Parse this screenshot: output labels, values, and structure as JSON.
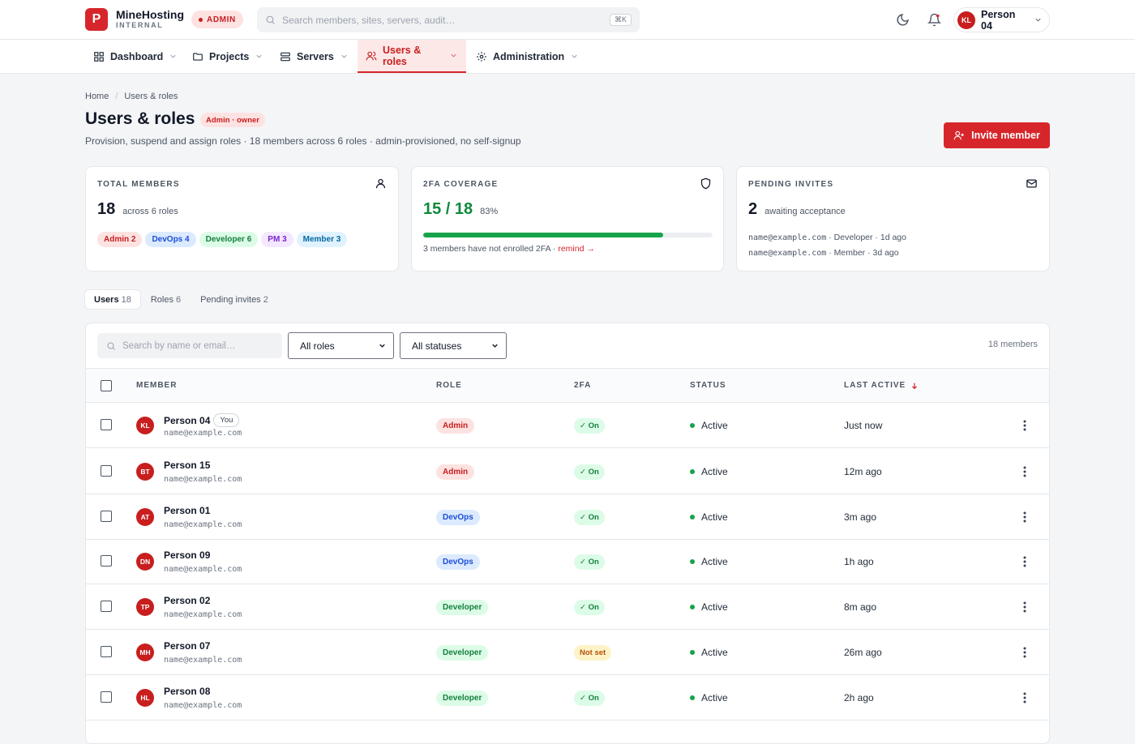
{
  "brand": {
    "logo_letter": "P",
    "name": "MineHosting",
    "sub": "INTERNAL",
    "env_badge": "ADMIN"
  },
  "search": {
    "placeholder": "Search members, sites, servers, audit…",
    "shortcut": "⌘K"
  },
  "user": {
    "initials": "KL",
    "name": "Person 04"
  },
  "nav": [
    {
      "label": "Dashboard",
      "icon": "dashboard-grid-icon"
    },
    {
      "label": "Projects",
      "icon": "folder-icon"
    },
    {
      "label": "Servers",
      "icon": "server-icon"
    },
    {
      "label": "Users & roles",
      "icon": "users-icon",
      "active": true
    },
    {
      "label": "Administration",
      "icon": "settings-icon"
    }
  ],
  "breadcrumb": [
    "Home",
    "Users & roles"
  ],
  "page": {
    "title": "Users & roles",
    "badge": "Admin · owner",
    "subtitle": "Provision, suspend and assign roles · 18 members across 6 roles · admin-provisioned, no self-signup",
    "invite_label": "Invite member"
  },
  "cards": {
    "members": {
      "label": "TOTAL MEMBERS",
      "value": "18",
      "note": "across 6 roles",
      "chips": [
        {
          "label": "Admin 2",
          "kind": "admin"
        },
        {
          "label": "DevOps 4",
          "kind": "devops"
        },
        {
          "label": "Developer 6",
          "kind": "developer"
        },
        {
          "label": "PM 3",
          "kind": "pm"
        },
        {
          "label": "Member 3",
          "kind": "member"
        }
      ]
    },
    "twofa": {
      "label": "2FA COVERAGE",
      "value": "15 / 18",
      "percent_label": "83%",
      "coverage": 0.83,
      "note": "3 members have not enrolled 2FA · ",
      "note_link": "remind →"
    },
    "invites": {
      "label": "PENDING INVITES",
      "value": "2",
      "note": "awaiting acceptance",
      "items": [
        {
          "email": "name@example.com",
          "detail": " · Developer · 1d ago"
        },
        {
          "email": "name@example.com",
          "detail": " · Member · 3d ago"
        }
      ]
    }
  },
  "tabs": [
    {
      "label": "Users",
      "count": "18",
      "active": true
    },
    {
      "label": "Roles",
      "count": "6"
    },
    {
      "label": "Pending invites",
      "count": "2"
    }
  ],
  "filters": {
    "search_placeholder": "Search by name or email…",
    "role_select": "All roles",
    "status_select": "All statuses",
    "count_label": "18 members"
  },
  "table": {
    "headers": {
      "member": "MEMBER",
      "role": "ROLE",
      "twofa": "2FA",
      "status": "STATUS",
      "last_active": "LAST ACTIVE"
    },
    "rows": [
      {
        "initials": "KL",
        "name": "Person 04",
        "you": "You",
        "email": "name@example.com",
        "role": "Admin",
        "role_kind": "admin",
        "twofa": "✓ On",
        "twofa_kind": "on",
        "status": "Active",
        "last": "Just now"
      },
      {
        "initials": "BT",
        "name": "Person 15",
        "email": "name@example.com",
        "role": "Admin",
        "role_kind": "admin",
        "twofa": "✓ On",
        "twofa_kind": "on",
        "status": "Active",
        "last": "12m ago"
      },
      {
        "initials": "AT",
        "name": "Person 01",
        "email": "name@example.com",
        "role": "DevOps",
        "role_kind": "devops",
        "twofa": "✓ On",
        "twofa_kind": "on",
        "status": "Active",
        "last": "3m ago"
      },
      {
        "initials": "DN",
        "name": "Person 09",
        "email": "name@example.com",
        "role": "DevOps",
        "role_kind": "devops",
        "twofa": "✓ On",
        "twofa_kind": "on",
        "status": "Active",
        "last": "1h ago"
      },
      {
        "initials": "TP",
        "name": "Person 02",
        "email": "name@example.com",
        "role": "Developer",
        "role_kind": "developer",
        "twofa": "✓ On",
        "twofa_kind": "on",
        "status": "Active",
        "last": "8m ago"
      },
      {
        "initials": "MH",
        "name": "Person 07",
        "email": "name@example.com",
        "role": "Developer",
        "role_kind": "developer",
        "twofa": "Not set",
        "twofa_kind": "notset",
        "status": "Active",
        "last": "26m ago"
      },
      {
        "initials": "HL",
        "name": "Person 08",
        "email": "name@example.com",
        "role": "Developer",
        "role_kind": "developer",
        "twofa": "✓ On",
        "twofa_kind": "on",
        "status": "Active",
        "last": "2h ago"
      }
    ]
  },
  "colors": {
    "accent": "#d7262b",
    "success": "#16a34a",
    "warning": "#b45309"
  }
}
